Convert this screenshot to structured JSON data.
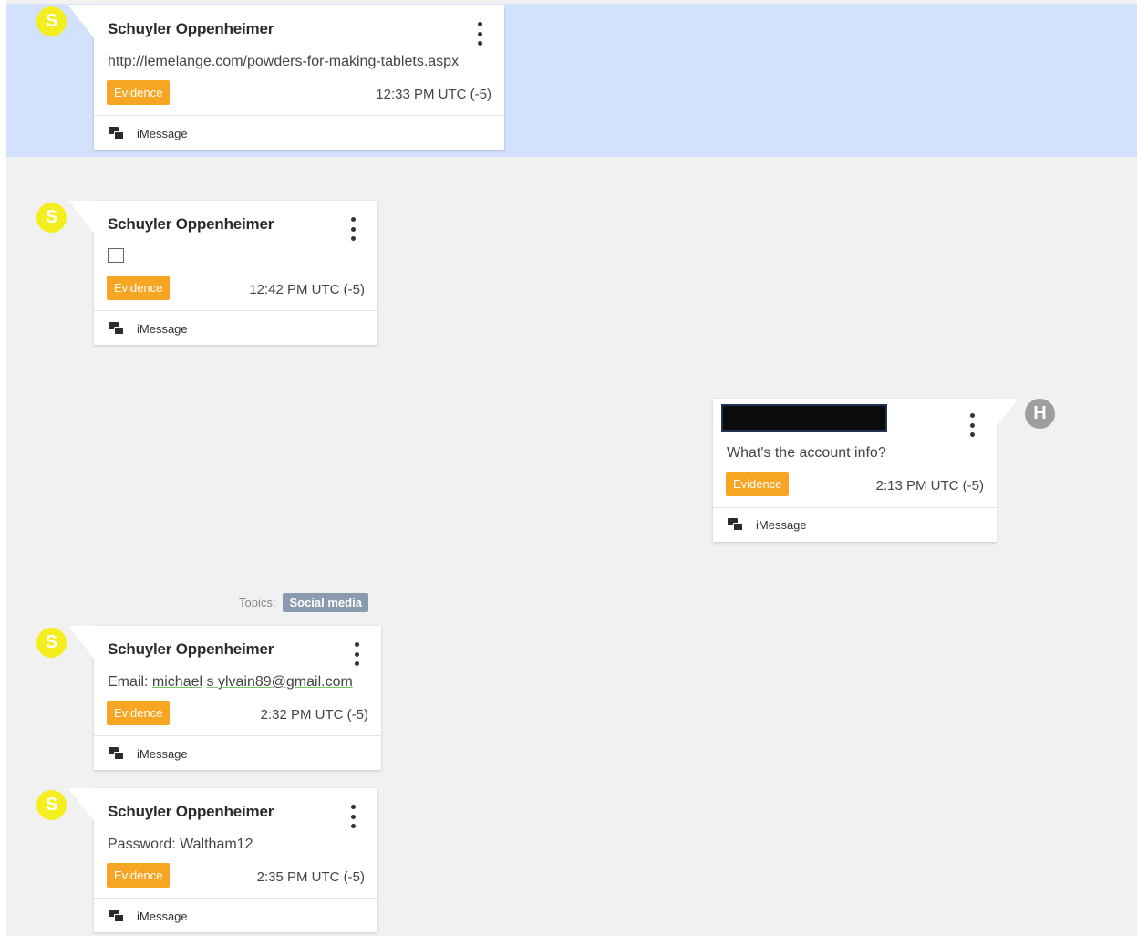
{
  "messages": [
    {
      "sender": "Schuyler Oppenheimer",
      "avatar_letter": "S",
      "text": "http://lemelange.com/powders-for-making-tablets.aspx",
      "evidence_label": "Evidence",
      "time": "12:33 PM UTC (-5)",
      "platform": "iMessage",
      "highlighted": true
    },
    {
      "sender": "Schuyler Oppenheimer",
      "avatar_letter": "S",
      "text": "",
      "evidence_label": "Evidence",
      "time": "12:42 PM UTC (-5)",
      "platform": "iMessage"
    },
    {
      "sender": "",
      "avatar_letter": "H",
      "text": "What's the account info?",
      "evidence_label": "Evidence",
      "time": "2:13 PM UTC (-5)",
      "platform": "iMessage",
      "sender_redacted": true
    },
    {
      "sender": "Schuyler Oppenheimer",
      "avatar_letter": "S",
      "text_prefix": "Email:",
      "text_parts": [
        "michael",
        "s ylvain89@gmail.com"
      ],
      "evidence_label": "Evidence",
      "time": "2:32 PM UTC (-5)",
      "platform": "iMessage"
    },
    {
      "sender": "Schuyler Oppenheimer",
      "avatar_letter": "S",
      "text": "Password: Waltham12",
      "evidence_label": "Evidence",
      "time": "2:35 PM UTC (-5)",
      "platform": "iMessage"
    }
  ],
  "topics": {
    "label": "Topics:",
    "tag": "Social media"
  },
  "colors": {
    "background": "#f1f1f1",
    "highlight": "#d3e2fc",
    "evidence": "#f6a623",
    "avatar_s": "#f5ee1f",
    "avatar_h": "#9e9e9e",
    "topic_tag": "#8a9bb0"
  },
  "icons": {
    "menu": "more-vert-icon",
    "platform": "chat-bubbles-icon"
  }
}
